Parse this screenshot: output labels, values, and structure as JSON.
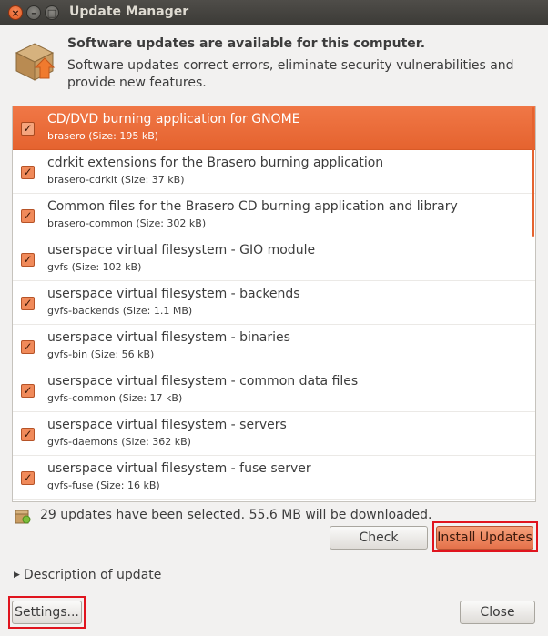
{
  "window": {
    "title": "Update Manager",
    "close_icon": "close-icon",
    "minimize_icon": "minimize-icon",
    "maximize_icon": "maximize-icon"
  },
  "header": {
    "icon": "package-update-icon",
    "headline": "Software updates are available for this computer.",
    "subline": "Software updates correct errors, eliminate security vulnerabilities and provide new features."
  },
  "updates": [
    {
      "title": "CD/DVD burning application for GNOME",
      "sub": "brasero (Size: 195 kB)",
      "checked": true,
      "selected": true
    },
    {
      "title": "cdrkit extensions for the Brasero burning application",
      "sub": "brasero-cdrkit (Size: 37 kB)",
      "checked": true,
      "selected": false
    },
    {
      "title": "Common files for the Brasero CD burning application and library",
      "sub": "brasero-common (Size: 302 kB)",
      "checked": true,
      "selected": false
    },
    {
      "title": "userspace virtual filesystem - GIO module",
      "sub": "gvfs (Size: 102 kB)",
      "checked": true,
      "selected": false
    },
    {
      "title": "userspace virtual filesystem - backends",
      "sub": "gvfs-backends (Size: 1.1 MB)",
      "checked": true,
      "selected": false
    },
    {
      "title": "userspace virtual filesystem - binaries",
      "sub": "gvfs-bin (Size: 56 kB)",
      "checked": true,
      "selected": false
    },
    {
      "title": "userspace virtual filesystem - common data files",
      "sub": "gvfs-common (Size: 17 kB)",
      "checked": true,
      "selected": false
    },
    {
      "title": "userspace virtual filesystem - servers",
      "sub": "gvfs-daemons (Size: 362 kB)",
      "checked": true,
      "selected": false
    },
    {
      "title": "userspace virtual filesystem - fuse server",
      "sub": "gvfs-fuse (Size: 16 kB)",
      "checked": true,
      "selected": false
    }
  ],
  "status": {
    "icon": "download-package-icon",
    "text": "29 updates have been selected. 55.6 MB will be downloaded."
  },
  "buttons": {
    "check": "Check",
    "install": "Install Updates",
    "settings": "Settings...",
    "close": "Close"
  },
  "expander": {
    "label": "Description of update"
  },
  "colors": {
    "accent": "#e5632f",
    "highlight_box": "#e0141e"
  }
}
